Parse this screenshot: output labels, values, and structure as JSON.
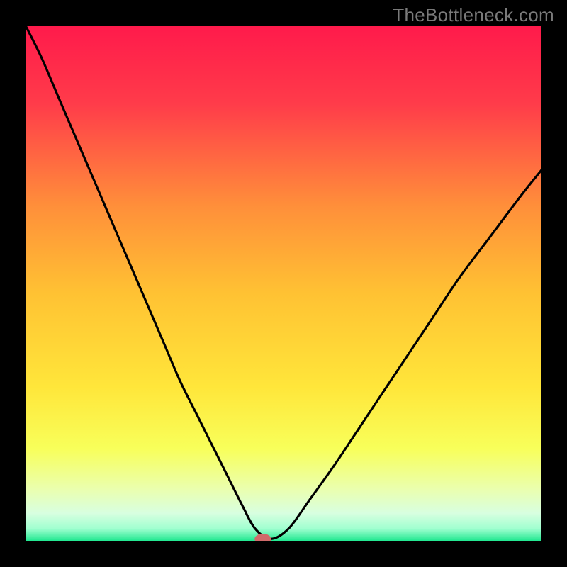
{
  "watermark_text": "TheBottleneck.com",
  "chart_data": {
    "type": "line",
    "title": "",
    "xlabel": "",
    "ylabel": "",
    "xlim": [
      0,
      100
    ],
    "ylim": [
      0,
      100
    ],
    "grid": false,
    "legend": "none",
    "background_gradient_stops": [
      {
        "offset": 0.0,
        "color": "#ff1a4b"
      },
      {
        "offset": 0.15,
        "color": "#ff3b4a"
      },
      {
        "offset": 0.35,
        "color": "#ff8f3a"
      },
      {
        "offset": 0.52,
        "color": "#ffc233"
      },
      {
        "offset": 0.7,
        "color": "#ffe63a"
      },
      {
        "offset": 0.82,
        "color": "#f8ff5a"
      },
      {
        "offset": 0.9,
        "color": "#eaffb0"
      },
      {
        "offset": 0.945,
        "color": "#d8ffe0"
      },
      {
        "offset": 0.975,
        "color": "#a0ffd0"
      },
      {
        "offset": 1.0,
        "color": "#19e68c"
      }
    ],
    "series": [
      {
        "name": "bottleneck-curve",
        "x": [
          0,
          3,
          6,
          9,
          12,
          15,
          18,
          21,
          24,
          27,
          30,
          33,
          36,
          39,
          42,
          44.5,
          47.5,
          51,
          55,
          60,
          66,
          72,
          78,
          84,
          90,
          96,
          100
        ],
        "y": [
          100,
          94,
          87,
          80,
          73,
          66,
          59,
          52,
          45,
          38,
          31,
          25,
          19,
          13,
          7,
          2.5,
          0.5,
          2.5,
          8,
          15,
          24,
          33,
          42,
          51,
          59,
          67,
          72
        ]
      }
    ],
    "marker": {
      "name": "optimal-point",
      "x": 46,
      "y": 0.5,
      "color": "#d06a6a",
      "rx": 1.6,
      "ry": 1.0
    }
  }
}
